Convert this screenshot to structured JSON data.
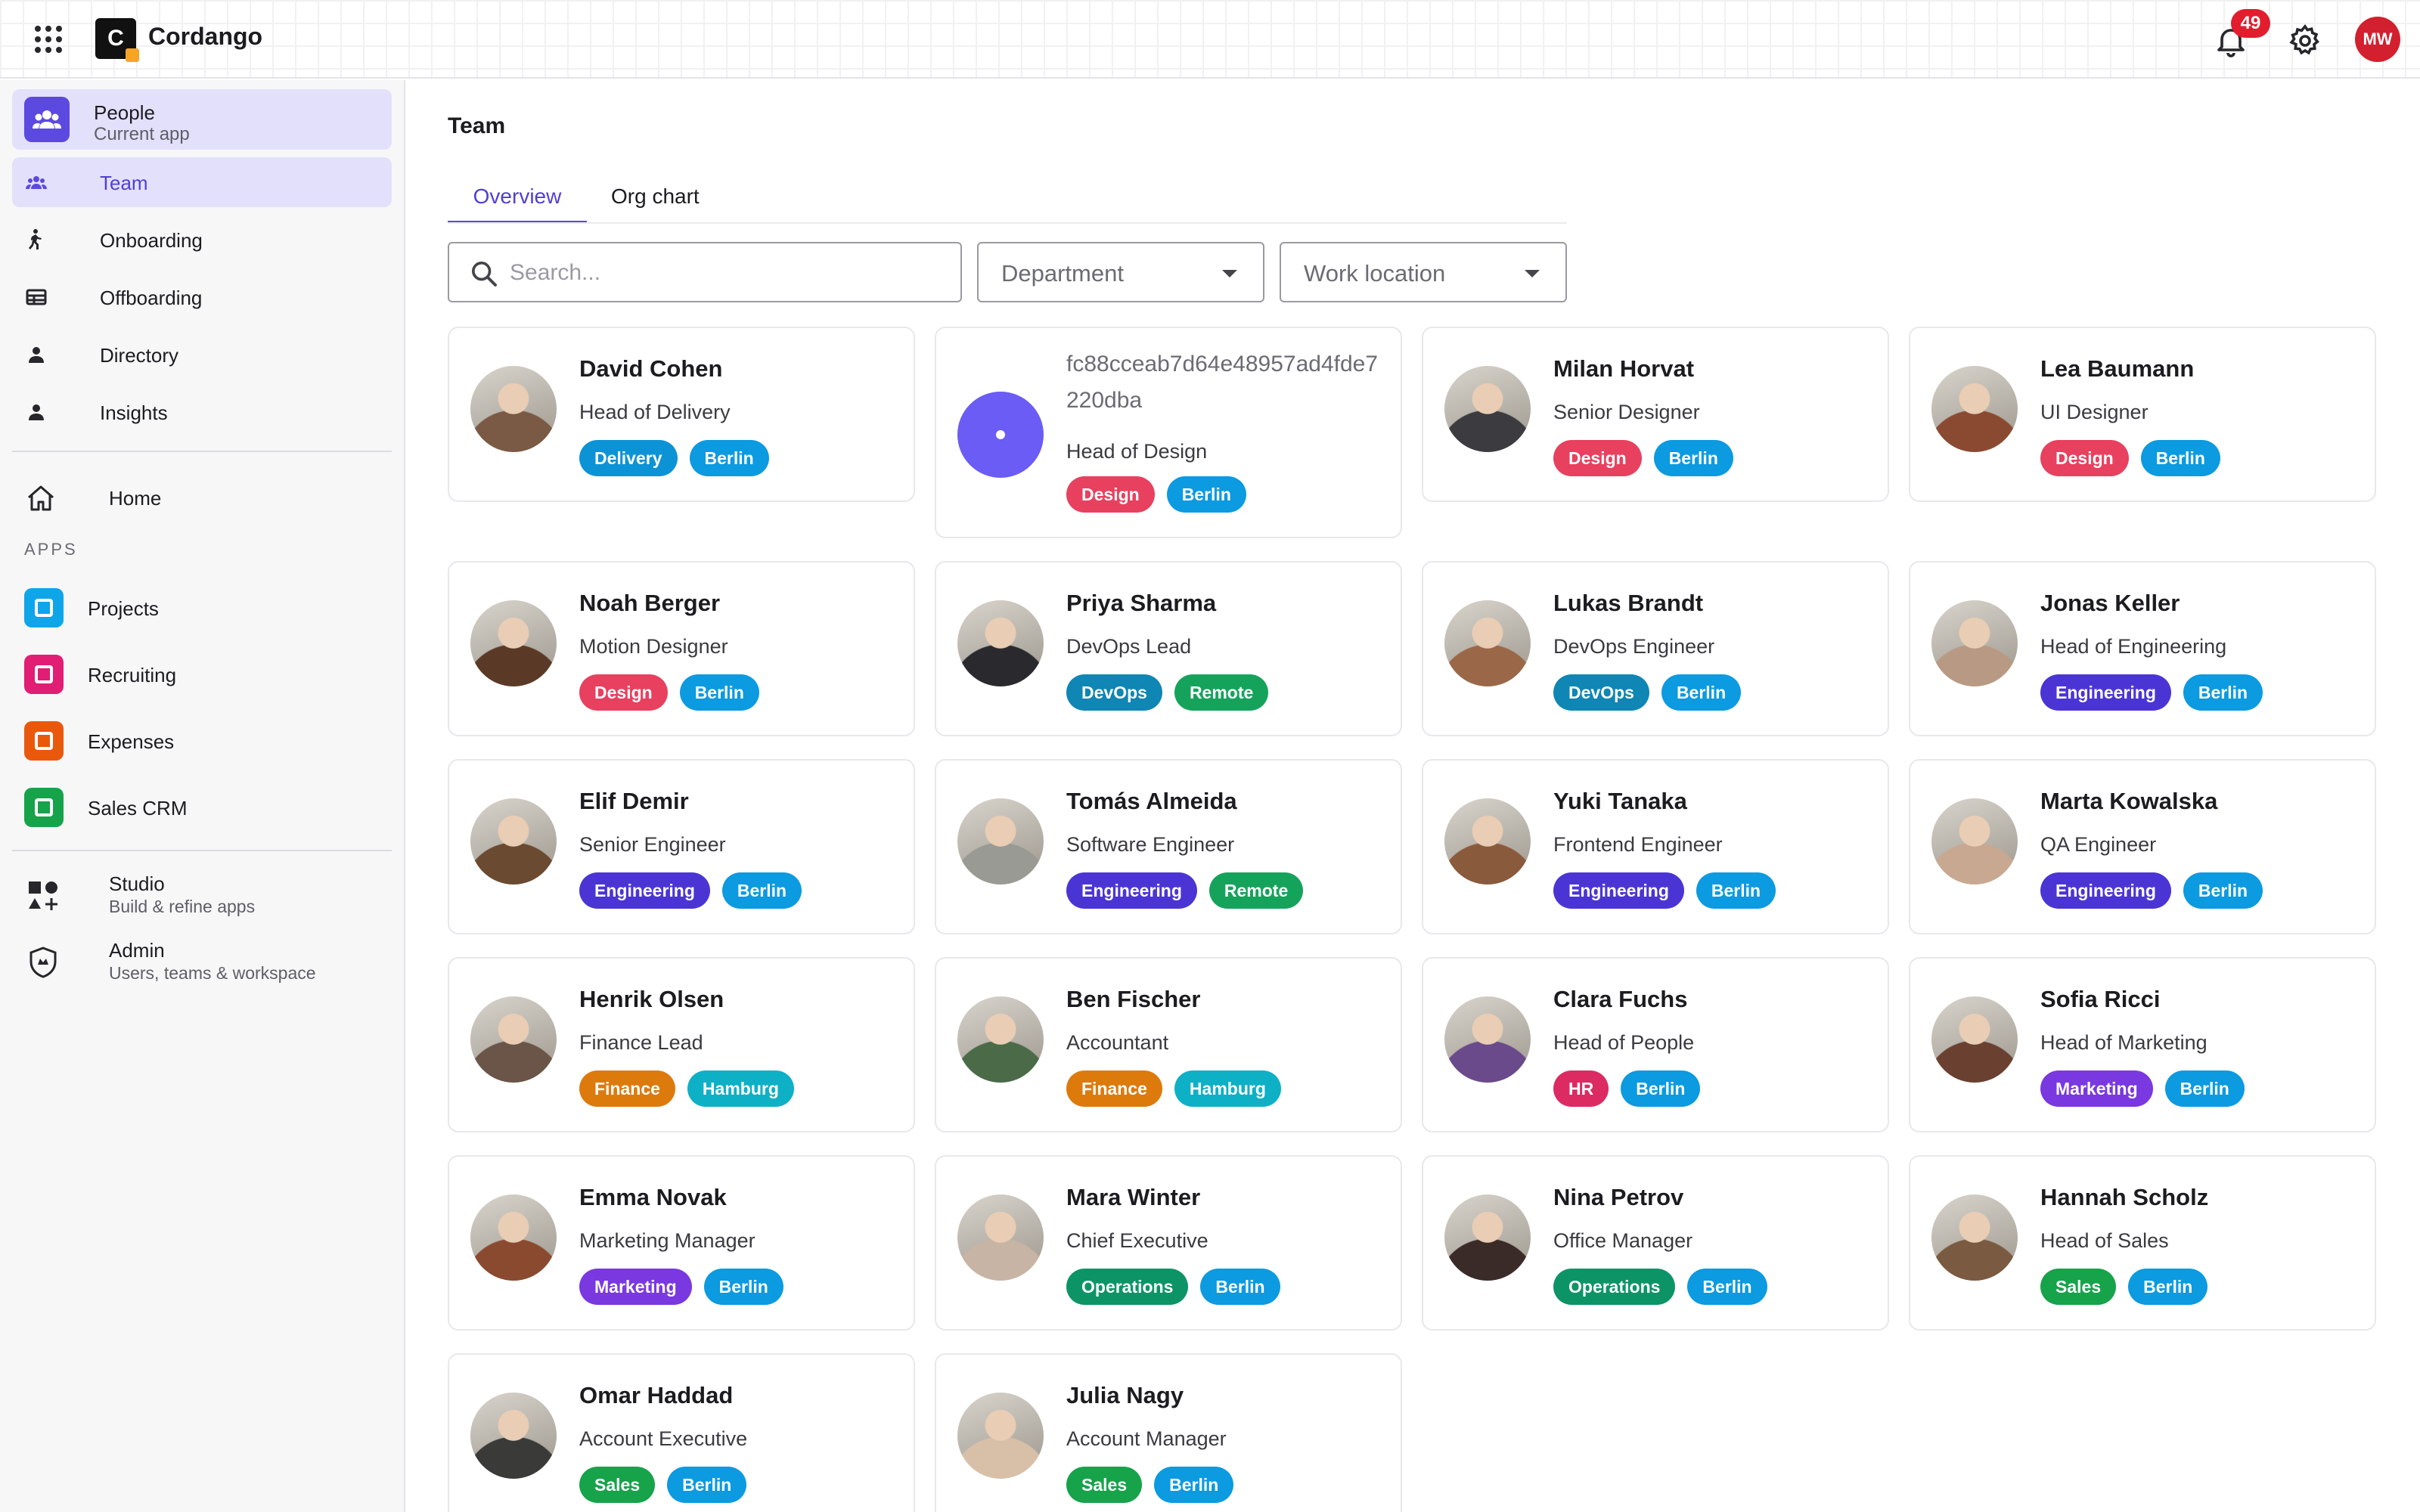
{
  "app": {
    "brand": "Cordango",
    "logo_letter": "C",
    "notification_count": "49",
    "user_initials": "MW"
  },
  "sidebar": {
    "current_app": {
      "title": "People",
      "subtitle": "Current app"
    },
    "items": [
      {
        "label": "Team",
        "icon": "team-icon",
        "active": true
      },
      {
        "label": "Onboarding",
        "icon": "walking-person-icon"
      },
      {
        "label": "Offboarding",
        "icon": "table-icon"
      },
      {
        "label": "Directory",
        "icon": "person-icon"
      },
      {
        "label": "Insights",
        "icon": "person-icon"
      }
    ],
    "home_label": "Home",
    "apps_heading": "APPS",
    "apps": [
      {
        "label": "Projects",
        "color": "#0ea5e9",
        "icon": "checklist-icon"
      },
      {
        "label": "Recruiting",
        "color": "#e11d74",
        "icon": "clipboard-icon"
      },
      {
        "label": "Expenses",
        "color": "#ea580c",
        "icon": "money-icon"
      },
      {
        "label": "Sales CRM",
        "color": "#16a34a",
        "icon": "handshake-icon"
      }
    ],
    "studio": {
      "title": "Studio",
      "subtitle": "Build & refine apps"
    },
    "admin": {
      "title": "Admin",
      "subtitle": "Users, teams & workspace"
    }
  },
  "main": {
    "title": "Team",
    "tabs": [
      "Overview",
      "Org chart"
    ],
    "search_placeholder": "Search...",
    "filters": {
      "department": "Department",
      "location": "Work location"
    }
  },
  "tag_colors": {
    "Delivery": "#0c93d6",
    "Design": "#e8405f",
    "DevOps": "#0f86b3",
    "Engineering": "#4a35d4",
    "Finance": "#dd7a0c",
    "HR": "#dc2a63",
    "Marketing": "#7a38e0",
    "Operations": "#0d9466",
    "Sales": "#16a34a",
    "Berlin": "#0c9ae0",
    "Hamburg": "#0eb0c6",
    "Remote": "#15a35c"
  },
  "people": [
    {
      "name": "David Cohen",
      "role": "Head of Delivery",
      "department": "Delivery",
      "location": "Berlin",
      "avatar_color": "#7a5a44"
    },
    {
      "name": "fc88cceab7d64e48957ad4fde7220dba",
      "role": "Head of Design",
      "department": "Design",
      "location": "Berlin",
      "placeholder": true
    },
    {
      "name": "Milan Horvat",
      "role": "Senior Designer",
      "department": "Design",
      "location": "Berlin",
      "avatar_color": "#3b3b40"
    },
    {
      "name": "Lea Baumann",
      "role": "UI Designer",
      "department": "Design",
      "location": "Berlin",
      "avatar_color": "#8a4a32"
    },
    {
      "name": "Noah Berger",
      "role": "Motion Designer",
      "department": "Design",
      "location": "Berlin",
      "avatar_color": "#5a3a26"
    },
    {
      "name": "Priya Sharma",
      "role": "DevOps Lead",
      "department": "DevOps",
      "location": "Remote",
      "avatar_color": "#2a2a2e"
    },
    {
      "name": "Lukas Brandt",
      "role": "DevOps Engineer",
      "department": "DevOps",
      "location": "Berlin",
      "avatar_color": "#9a6848"
    },
    {
      "name": "Jonas Keller",
      "role": "Head of Engineering",
      "department": "Engineering",
      "location": "Berlin",
      "avatar_color": "#b89a84"
    },
    {
      "name": "Elif Demir",
      "role": "Senior Engineer",
      "department": "Engineering",
      "location": "Berlin",
      "avatar_color": "#6a4a30"
    },
    {
      "name": "Tomás Almeida",
      "role": "Software Engineer",
      "department": "Engineering",
      "location": "Remote",
      "avatar_color": "#9a9a94"
    },
    {
      "name": "Yuki Tanaka",
      "role": "Frontend Engineer",
      "department": "Engineering",
      "location": "Berlin",
      "avatar_color": "#8a5a3c"
    },
    {
      "name": "Marta Kowalska",
      "role": "QA Engineer",
      "department": "Engineering",
      "location": "Berlin",
      "avatar_color": "#c8a890"
    },
    {
      "name": "Henrik Olsen",
      "role": "Finance Lead",
      "department": "Finance",
      "location": "Hamburg",
      "avatar_color": "#6a5548"
    },
    {
      "name": "Ben Fischer",
      "role": "Accountant",
      "department": "Finance",
      "location": "Hamburg",
      "avatar_color": "#4a6a48"
    },
    {
      "name": "Clara Fuchs",
      "role": "Head of People",
      "department": "HR",
      "location": "Berlin",
      "avatar_color": "#6a4a8a"
    },
    {
      "name": "Sofia Ricci",
      "role": "Head of Marketing",
      "department": "Marketing",
      "location": "Berlin",
      "avatar_color": "#6a4030"
    },
    {
      "name": "Emma Novak",
      "role": "Marketing Manager",
      "department": "Marketing",
      "location": "Berlin",
      "avatar_color": "#8a4a30"
    },
    {
      "name": "Mara Winter",
      "role": "Chief Executive",
      "department": "Operations",
      "location": "Berlin",
      "avatar_color": "#c8b4a4"
    },
    {
      "name": "Nina Petrov",
      "role": "Office Manager",
      "department": "Operations",
      "location": "Berlin",
      "avatar_color": "#3a2a28"
    },
    {
      "name": "Hannah Scholz",
      "role": "Head of Sales",
      "department": "Sales",
      "location": "Berlin",
      "avatar_color": "#7a5a40"
    },
    {
      "name": "Omar Haddad",
      "role": "Account Executive",
      "department": "Sales",
      "location": "Berlin",
      "avatar_color": "#3a3a38"
    },
    {
      "name": "Julia Nagy",
      "role": "Account Manager",
      "department": "Sales",
      "location": "Berlin",
      "avatar_color": "#d8c0a8"
    }
  ]
}
